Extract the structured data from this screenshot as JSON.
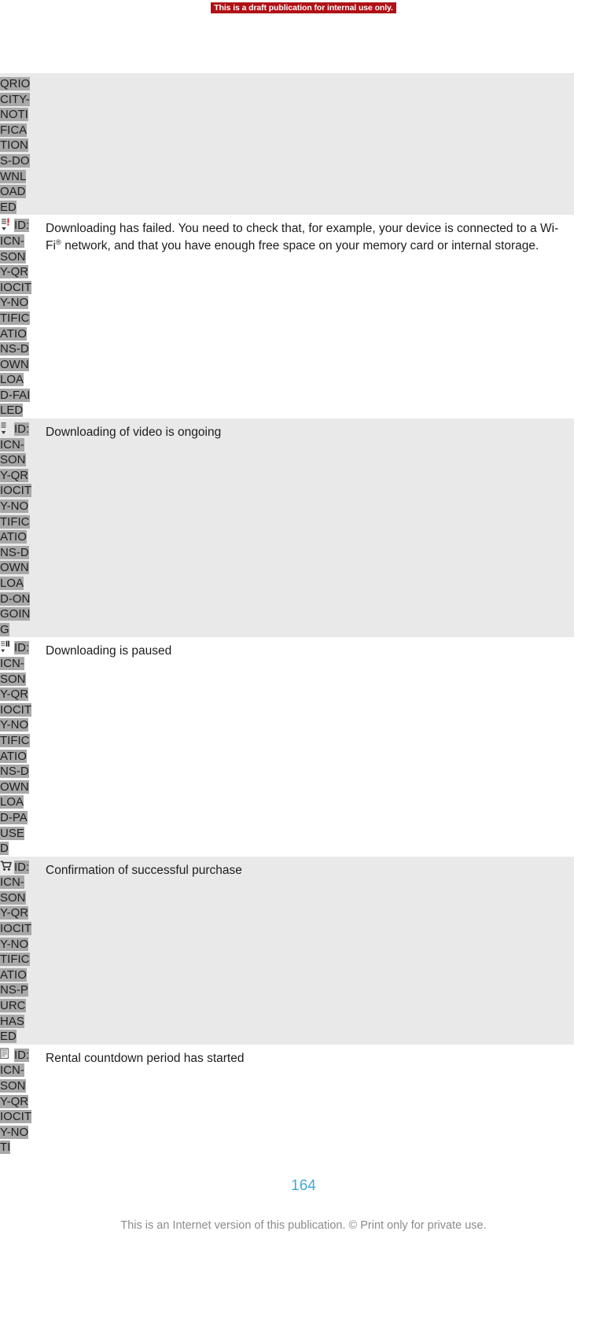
{
  "banner": {
    "text": "This is a draft publication for internal use only.",
    "background_color": "#b01116",
    "text_color": "#ffffff"
  },
  "table": {
    "rows": [
      {
        "icon": "none",
        "id_prefix": "",
        "id_text": "QRIOCITY-NOTIFICATIONS-DOWNLOADED",
        "description": "",
        "shaded": true
      },
      {
        "icon": "download-failed-icon",
        "id_prefix": "ID:",
        "id_text": "ICN-SONY-QRIOCITY-NOTIFICATIONS-DOWNLOAD-FAILED",
        "description": "Downloading has failed. You need to check that, for example, your device is connected to a Wi-Fi® network, and that you have enough free space on your memory card or internal storage.",
        "shaded": false
      },
      {
        "icon": "download-ongoing-icon",
        "id_prefix": "ID:",
        "id_text": "ICN-SONY-QRIOCITY-NOTIFICATIONS-DOWNLOAD-ONGOING",
        "description": "Downloading of video is ongoing",
        "shaded": true
      },
      {
        "icon": "download-paused-icon",
        "id_prefix": "ID:",
        "id_text": "ICN-SONY-QRIOCITY-NOTIFICATIONS-DOWNLOAD-PAUSED",
        "description": "Downloading is paused",
        "shaded": false
      },
      {
        "icon": "shopping-cart-icon",
        "id_prefix": "ID:",
        "id_text": "ICN-SONY-QRIOCITY-NOTIFICATIONS-PURCHASED",
        "description": "Confirmation of successful purchase",
        "shaded": true
      },
      {
        "icon": "rental-countdown-icon",
        "id_prefix": "ID:",
        "id_text": "ICN-SONY-QRIOCITY-NOTI",
        "description": "Rental countdown period has started",
        "shaded": false
      }
    ]
  },
  "footer": {
    "page_number": "164",
    "note": "This is an Internet version of this publication. © Print only for private use.",
    "page_number_color": "#3fa9dd",
    "note_color": "#8b8b8b"
  }
}
